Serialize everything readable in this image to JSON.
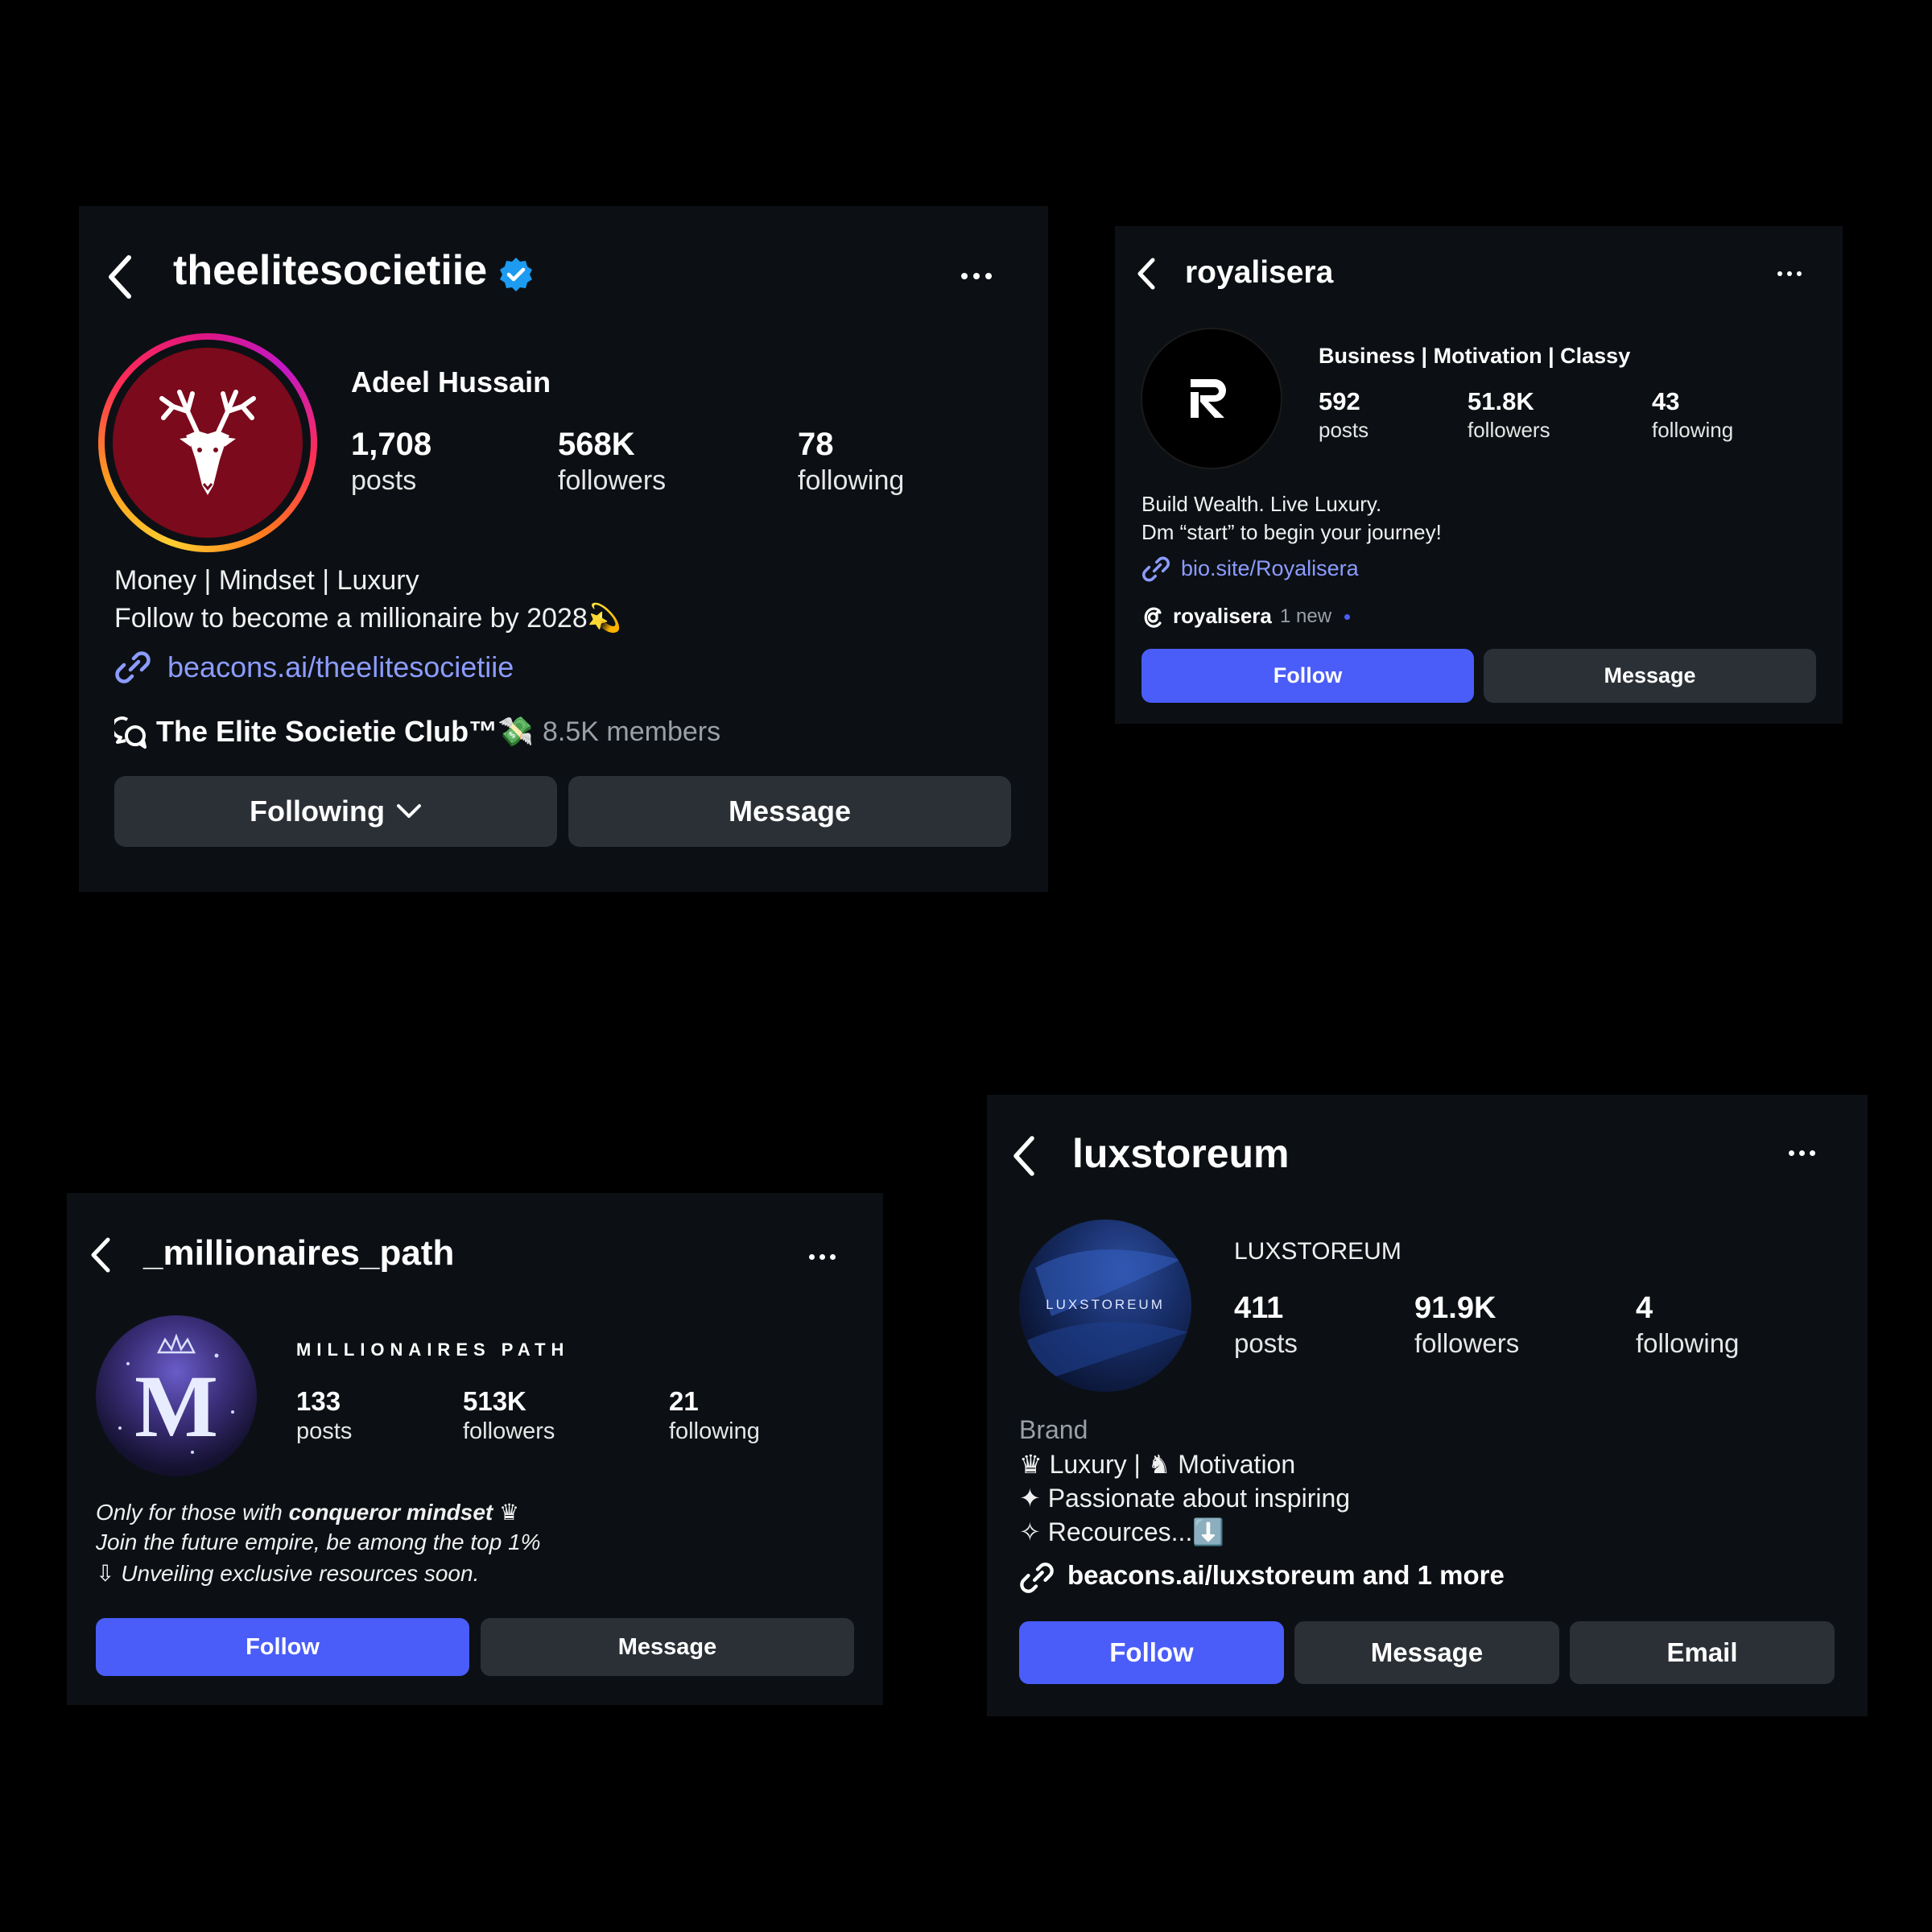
{
  "colors": {
    "page_bg": "#000000",
    "card_bg": "#0c1014",
    "button_gray": "#2b3036",
    "button_blue": "#4a5df9",
    "link": "#8c9cff",
    "verified": "#1d9bf0",
    "avatar_red": "#7a0a1c"
  },
  "profiles": [
    {
      "username": "theelitesocietiie",
      "verified": true,
      "display_name": "Adeel Hussain",
      "stats": [
        {
          "value": "1,708",
          "label": "posts"
        },
        {
          "value": "568K",
          "label": "followers"
        },
        {
          "value": "78",
          "label": "following"
        }
      ],
      "bio": [
        "Money | Mindset | Luxury",
        "Follow to become a millionaire by 2028💫"
      ],
      "link": "beacons.ai/theelitesocietiie",
      "community": {
        "name": "The Elite Societie Club™💸",
        "members": "8.5K members"
      },
      "buttons": [
        "Following",
        "Message"
      ],
      "avatar_icon": "deer-head-icon"
    },
    {
      "username": "royalisera",
      "display_name": "Business | Motivation | Classy",
      "stats": [
        {
          "value": "592",
          "label": "posts"
        },
        {
          "value": "51.8K",
          "label": "followers"
        },
        {
          "value": "43",
          "label": "following"
        }
      ],
      "bio": [
        "Build Wealth. Live Luxury.",
        "Dm “start” to begin your journey!"
      ],
      "link": "bio.site/Royalisera",
      "threads": {
        "name": "royalisera",
        "badge": "1 new"
      },
      "buttons": [
        "Follow",
        "Message"
      ],
      "avatar_letter": "R"
    },
    {
      "username": "_millionaires_path",
      "display_name": "MILLIONAIRES PATH",
      "stats": [
        {
          "value": "133",
          "label": "posts"
        },
        {
          "value": "513K",
          "label": "followers"
        },
        {
          "value": "21",
          "label": "following"
        }
      ],
      "bio": {
        "line1_prefix": "Only for those with ",
        "line1_bold": "conqueror mindset",
        "line1_suffix": " ♛",
        "line2": "Join the future empire, be among the top 1%",
        "line3": "⇩ Unveiling exclusive resources soon."
      },
      "buttons": [
        "Follow",
        "Message"
      ],
      "avatar_letter": "M"
    },
    {
      "username": "luxstoreum",
      "display_name": "LUXSTOREUM",
      "stats": [
        {
          "value": "411",
          "label": "posts"
        },
        {
          "value": "91.9K",
          "label": "followers"
        },
        {
          "value": "4",
          "label": "following"
        }
      ],
      "category": "Brand",
      "bio": [
        "♛ Luxury | ♞ Motivation",
        "✦ Passionate about inspiring",
        "✧ Recources...⬇️"
      ],
      "link": "beacons.ai/luxstoreum and 1 more",
      "buttons": [
        "Follow",
        "Message",
        "Email"
      ],
      "avatar_text": "LUXSTOREUM"
    }
  ]
}
